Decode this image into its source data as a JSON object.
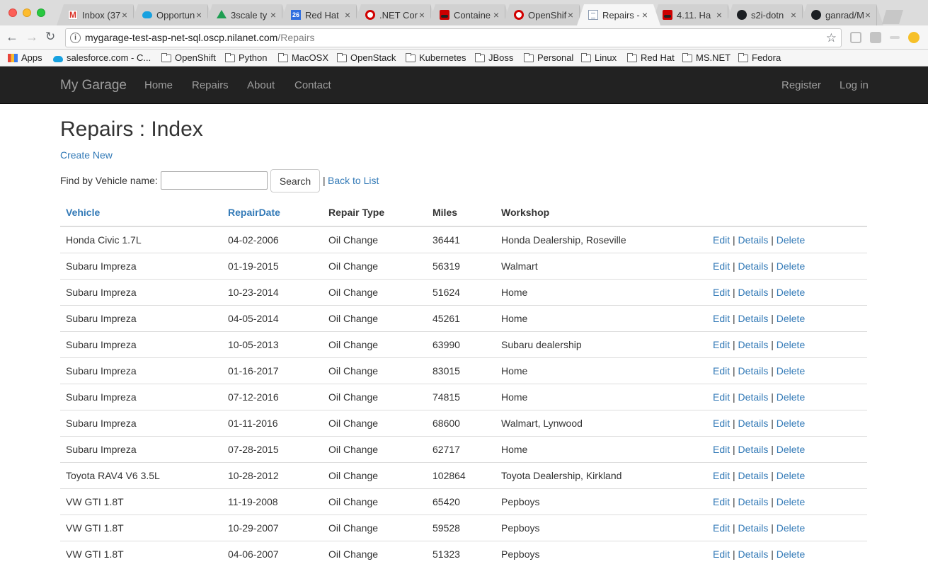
{
  "browser": {
    "tabs": [
      {
        "title": "Inbox (37",
        "icon": "gmail-icon",
        "active": false
      },
      {
        "title": "Opportun",
        "icon": "salesforce-icon",
        "active": false
      },
      {
        "title": "3scale ty",
        "icon": "google-drive-icon",
        "active": false
      },
      {
        "title": "Red Hat",
        "icon": "google-calendar-icon",
        "active": false
      },
      {
        "title": ".NET Cor",
        "icon": "openshift-icon",
        "active": false
      },
      {
        "title": "Containe",
        "icon": "redhat-icon",
        "active": false
      },
      {
        "title": "OpenShif",
        "icon": "openshift-icon",
        "active": false
      },
      {
        "title": "Repairs -",
        "icon": "page-icon",
        "active": true
      },
      {
        "title": "4.11. Ha",
        "icon": "redhat-icon",
        "active": false
      },
      {
        "title": "s2i-dotn",
        "icon": "github-icon",
        "active": false
      },
      {
        "title": "ganrad/M",
        "icon": "github-icon",
        "active": false
      }
    ],
    "calendar_day": "26",
    "tab_close_glyph": "×",
    "url_host": "mygarage-test-asp-net-sql.oscp.nilanet.com",
    "url_path": "/Repairs",
    "bookmarks": [
      {
        "label": "Apps",
        "icon": "apps-icon"
      },
      {
        "label": "salesforce.com - C...",
        "icon": "salesforce-icon"
      },
      {
        "label": "OpenShift",
        "icon": "folder-icon"
      },
      {
        "label": "Python",
        "icon": "folder-icon"
      },
      {
        "label": "MacOSX",
        "icon": "folder-icon"
      },
      {
        "label": "OpenStack",
        "icon": "folder-icon"
      },
      {
        "label": "Kubernetes",
        "icon": "folder-icon"
      },
      {
        "label": "JBoss",
        "icon": "folder-icon"
      },
      {
        "label": "Personal",
        "icon": "folder-icon"
      },
      {
        "label": "Linux",
        "icon": "folder-icon"
      },
      {
        "label": "Red Hat",
        "icon": "folder-icon"
      },
      {
        "label": "MS.NET",
        "icon": "folder-icon"
      },
      {
        "label": "Fedora",
        "icon": "folder-icon"
      }
    ]
  },
  "navbar": {
    "brand": "My Garage",
    "links": [
      "Home",
      "Repairs",
      "About",
      "Contact"
    ],
    "register": "Register",
    "login": "Log in"
  },
  "page": {
    "title": "Repairs : Index",
    "create_new": "Create New",
    "search_label": "Find by Vehicle name:",
    "search_value": "",
    "search_button": "Search",
    "separator": "|",
    "back_to_list": "Back to List"
  },
  "table": {
    "headers": {
      "vehicle": "Vehicle",
      "repair_date": "RepairDate",
      "repair_type": "Repair Type",
      "miles": "Miles",
      "workshop": "Workshop"
    },
    "actions": {
      "edit": "Edit",
      "details": "Details",
      "delete": "Delete",
      "sep": "|"
    },
    "rows": [
      {
        "vehicle": "Honda Civic 1.7L",
        "date": "04-02-2006",
        "type": "Oil Change",
        "miles": "36441",
        "workshop": "Honda Dealership, Roseville"
      },
      {
        "vehicle": "Subaru Impreza",
        "date": "01-19-2015",
        "type": "Oil Change",
        "miles": "56319",
        "workshop": "Walmart"
      },
      {
        "vehicle": "Subaru Impreza",
        "date": "10-23-2014",
        "type": "Oil Change",
        "miles": "51624",
        "workshop": "Home"
      },
      {
        "vehicle": "Subaru Impreza",
        "date": "04-05-2014",
        "type": "Oil Change",
        "miles": "45261",
        "workshop": "Home"
      },
      {
        "vehicle": "Subaru Impreza",
        "date": "10-05-2013",
        "type": "Oil Change",
        "miles": "63990",
        "workshop": "Subaru dealership"
      },
      {
        "vehicle": "Subaru Impreza",
        "date": "01-16-2017",
        "type": "Oil Change",
        "miles": "83015",
        "workshop": "Home"
      },
      {
        "vehicle": "Subaru Impreza",
        "date": "07-12-2016",
        "type": "Oil Change",
        "miles": "74815",
        "workshop": "Home"
      },
      {
        "vehicle": "Subaru Impreza",
        "date": "01-11-2016",
        "type": "Oil Change",
        "miles": "68600",
        "workshop": "Walmart, Lynwood"
      },
      {
        "vehicle": "Subaru Impreza",
        "date": "07-28-2015",
        "type": "Oil Change",
        "miles": "62717",
        "workshop": "Home"
      },
      {
        "vehicle": "Toyota RAV4 V6 3.5L",
        "date": "10-28-2012",
        "type": "Oil Change",
        "miles": "102864",
        "workshop": "Toyota Dealership, Kirkland"
      },
      {
        "vehicle": "VW GTI 1.8T",
        "date": "11-19-2008",
        "type": "Oil Change",
        "miles": "65420",
        "workshop": "Pepboys"
      },
      {
        "vehicle": "VW GTI 1.8T",
        "date": "10-29-2007",
        "type": "Oil Change",
        "miles": "59528",
        "workshop": "Pepboys"
      },
      {
        "vehicle": "VW GTI 1.8T",
        "date": "04-06-2007",
        "type": "Oil Change",
        "miles": "51323",
        "workshop": "Pepboys"
      }
    ]
  },
  "colors": {
    "link": "#337ab7",
    "navbar_bg": "#222222",
    "navbar_text": "#9d9d9d"
  }
}
